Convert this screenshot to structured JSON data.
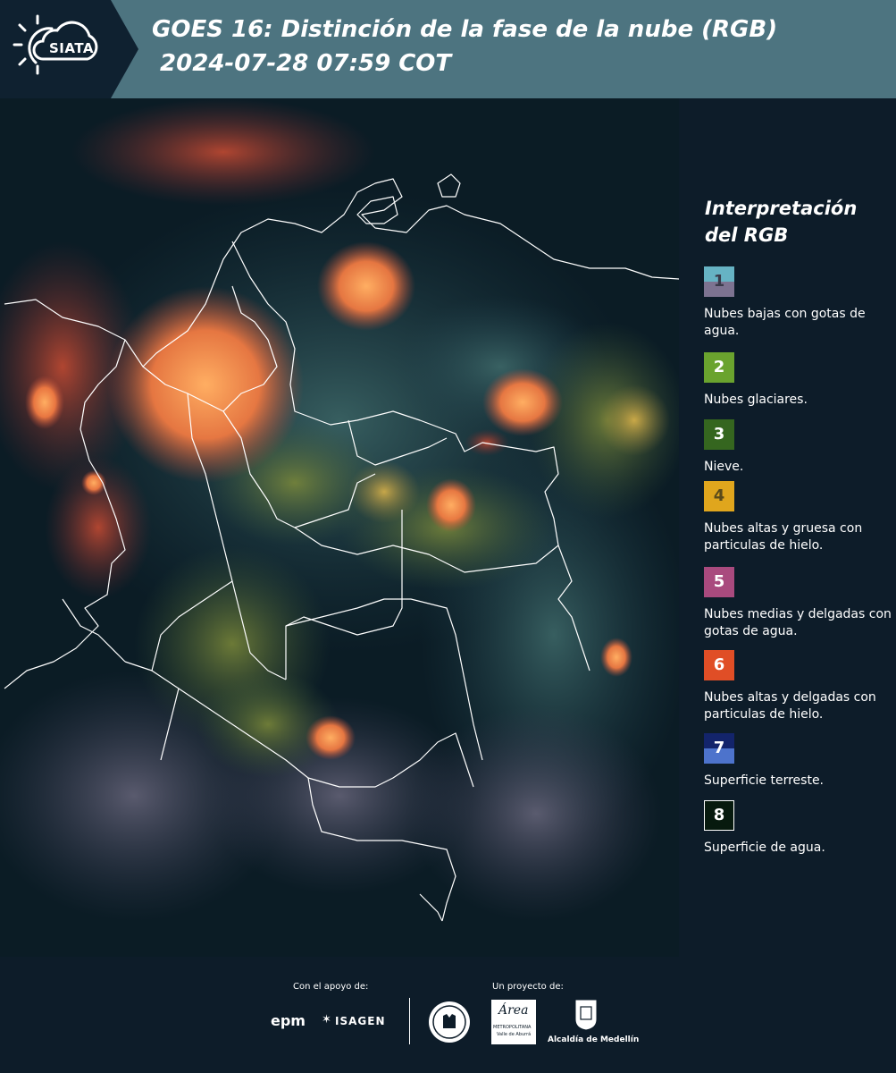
{
  "header": {
    "logo_text": "SIATA",
    "title": "GOES 16: Distinción de la fase de la nube (RGB)\n 2024-07-28 07:59 COT"
  },
  "legend": {
    "title": "Interpretación del RGB",
    "items": [
      {
        "num": "1",
        "label": "Nubes bajas con gotas de agua.",
        "colors": [
          "#66b3c4",
          "#7d7391"
        ]
      },
      {
        "num": "2",
        "label": "Nubes glaciares.",
        "colors": [
          "#6aa32e"
        ]
      },
      {
        "num": "3",
        "label": "Nieve.",
        "colors": [
          "#35661f"
        ]
      },
      {
        "num": "4",
        "label": "Nubes altas y gruesa con particulas de hielo.",
        "colors": [
          "#e0a61d"
        ]
      },
      {
        "num": "5",
        "label": "Nubes medias y delgadas con gotas de agua.",
        "colors": [
          "#a94a7e"
        ]
      },
      {
        "num": "6",
        "label": "Nubes altas y delgadas con particulas de hielo.",
        "colors": [
          "#e04e26"
        ]
      },
      {
        "num": "7",
        "label": "Superficie terreste.",
        "colors": [
          "#13246b",
          "#4d73cc"
        ]
      },
      {
        "num": "8",
        "label": "Superficie de agua.",
        "colors": [
          "#071a0e"
        ]
      }
    ]
  },
  "footer": {
    "support_label": "Con el apoyo de:",
    "project_label": "Un proyecto de:",
    "logo_epm": "epm",
    "logo_isagen": "ISAGEN",
    "logo_area": "Área",
    "logo_area_sub": "METROPOLITANA",
    "logo_area_sub2": "Valle de Aburrá",
    "logo_alcaldia": "Alcaldía de Medellín"
  }
}
